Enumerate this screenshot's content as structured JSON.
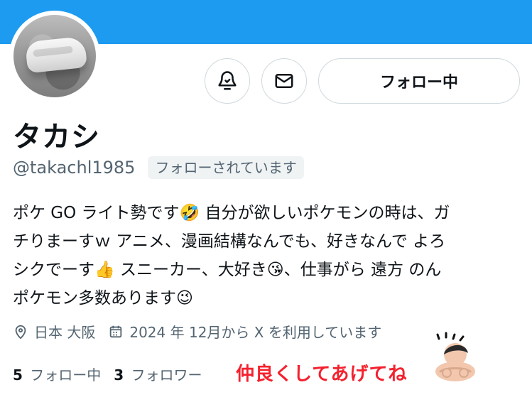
{
  "colors": {
    "accent": "#1d9bf0",
    "text": "#0f1419",
    "muted": "#536471",
    "border": "#cfd9de",
    "chip_bg": "#eff3f4",
    "overlay_text": "#f4212e"
  },
  "profile": {
    "display_name": "タカシ",
    "handle": "@takachl1985",
    "follows_you": "フォローされています",
    "bio": "ポケ GO ライト勢です🤣 自分が欲しいポケモンの時は、ガ\nチりまーすｗ アニメ、漫画結構なんでも、好きなんで よろ\nシクでーす👍 スニーカー、大好き😘、仕事がら 遠方 のん\nポケモン多数あります😉",
    "location": "日本 大阪",
    "joined": "2024 年 12月から X を利用しています"
  },
  "actions": {
    "notify_icon": "bell-check-icon",
    "mail_icon": "mail-icon",
    "following_button": "フォロー中"
  },
  "stats": {
    "following_count": "5",
    "following_label": "フォロー中",
    "followers_count": "3",
    "followers_label": "フォロワー"
  },
  "overlay": {
    "text": "仲良くしてあげてね",
    "emoji": "🙇🏻"
  }
}
